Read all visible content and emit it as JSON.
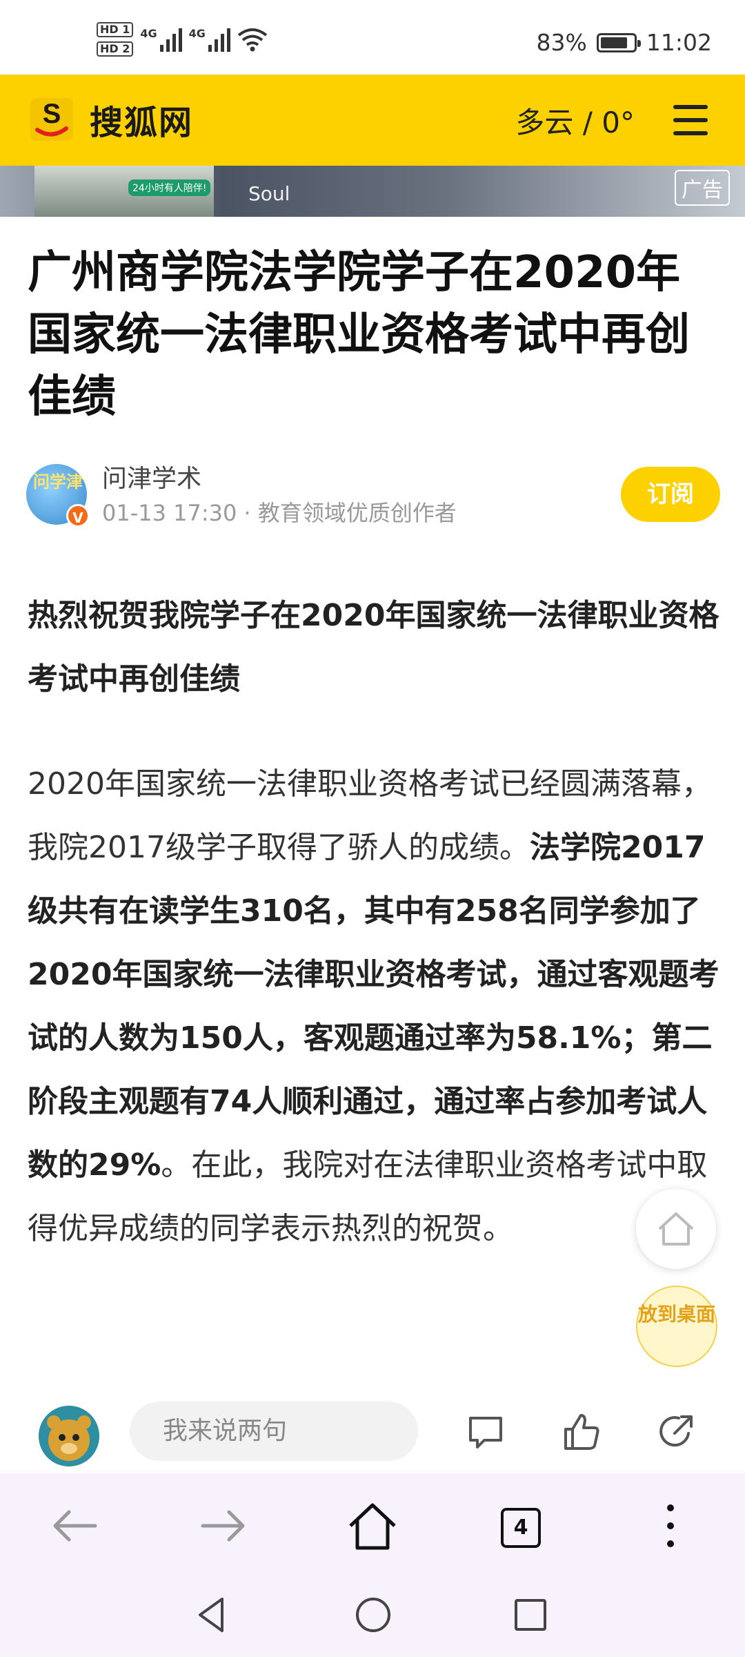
{
  "status_bar": {
    "hd1": "HD 1",
    "hd2": "HD 2",
    "net1": "4G",
    "net2": "4G",
    "battery_text": "83%",
    "battery_level": 0.83,
    "time": "11:02"
  },
  "header": {
    "brand": "搜狐网",
    "weather": "多云 / 0°",
    "accent_color": "#fdd000"
  },
  "ad": {
    "thumb_text": "24小时有人陪伴!",
    "source": "Soul",
    "tag": "广告"
  },
  "article": {
    "title": "广州商学院法学院学子在2020年国家统一法律职业资格考试中再创佳绩",
    "author": {
      "avatar_text": "问学津",
      "verified_label": "V",
      "name": "问津学术",
      "meta": "01-13 17:30 · 教育领域优质创作者",
      "subscribe_label": "订阅"
    },
    "lead": "热烈祝贺我院学子在2020年国家统一法律职业资格考试中再创佳绩",
    "body": {
      "p1": "2020年国家统一法律职业资格考试已经圆满落幕，我院2017级学子取得了骄人的成绩。",
      "p1_bold": "法学院2017级共有在读学生310名，其中有258名同学参加了2020年国家统一法律职业资格考试，通过客观题考试的人数为150人，客观题通过率为58.1%；第二阶段主观题有74人顺利通过，通过率占参加考试人数的29%",
      "p1_end": "。在此，我院对在法律职业资格考试中取得优异成绩的同学表示热烈的祝贺。"
    }
  },
  "floating": {
    "home_icon": "home-outline-icon",
    "desktop_label": "放到桌面"
  },
  "comment_bar": {
    "placeholder": "我来说两句",
    "icons": [
      "comment-icon",
      "thumbs-up-icon",
      "share-icon"
    ]
  },
  "browser_nav": {
    "tab_count": "4",
    "icons": [
      "back-arrow-icon",
      "forward-arrow-icon",
      "home-icon",
      "tabs-icon",
      "more-vertical-icon"
    ]
  },
  "system_nav": {
    "icons": [
      "back-triangle-icon",
      "home-circle-icon",
      "recents-square-icon"
    ]
  }
}
